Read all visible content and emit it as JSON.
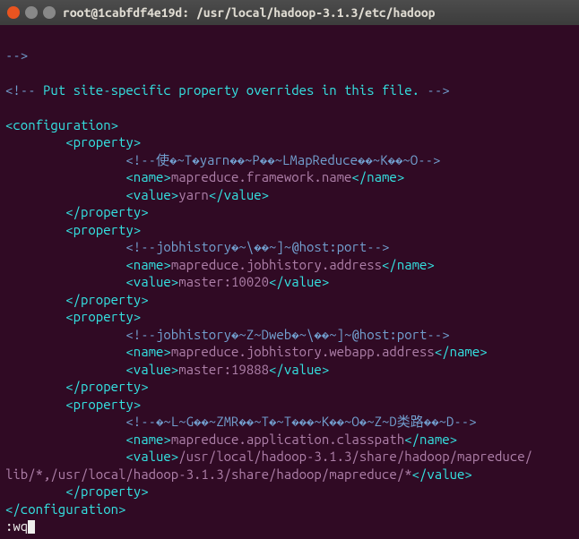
{
  "window": {
    "title": "root@1cabfdf4e19d: /usr/local/hadoop-3.1.3/etc/hadoop"
  },
  "lines": {
    "comment_close": "-->",
    "site_comment_open": "<!--",
    "site_comment_text": " Put site-specific property overrides in this file. ",
    "site_comment_close": "-->",
    "tag_config_open": "<configuration>",
    "tag_prop_open": "<property>",
    "tag_prop_close": "</property>",
    "tag_name_open": "<name>",
    "tag_name_close": "</name>",
    "tag_value_open": "<value>",
    "tag_value_close": "</value>",
    "tag_config_close": "</configuration>",
    "p1_comment": "<!--使�~T�yarn��~P��~LMapReduce��~K��~O-->",
    "p1_name": "mapreduce.framework.name",
    "p1_value": "yarn",
    "p2_comment": "<!--jobhistory�~\\��~]~@host:port-->",
    "p2_name": "mapreduce.jobhistory.address",
    "p2_value": "master:10020",
    "p3_comment": "<!--jobhistory�~Z~Dweb�~\\��~]~@host:port-->",
    "p3_name": "mapreduce.jobhistory.webapp.address",
    "p3_value": "master:19888",
    "p4_comment": "<!--�~L~G��~ZMR��~T�~T���~K��~O�~Z~D类路��~D-->",
    "p4_name": "mapreduce.application.classpath",
    "p4_value_line1": "/usr/local/hadoop-3.1.3/share/hadoop/mapreduce/",
    "p4_value_line2": "lib/*,/usr/local/hadoop-3.1.3/share/hadoop/mapreduce/*",
    "vim_command": ":wq"
  }
}
